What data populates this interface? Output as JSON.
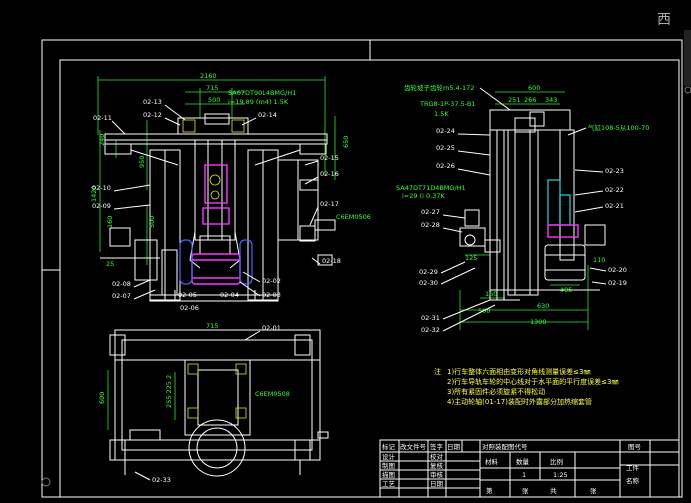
{
  "watermark": "西",
  "dims": {
    "d2160": "2160",
    "d715a": "715",
    "d500a": "500",
    "d240": "240",
    "d1420": "1420",
    "d950": "950",
    "d160a": "160",
    "d500v": "500",
    "d25": "25",
    "d650": "650",
    "d715b": "715",
    "d600b": "600",
    "d600r": "600",
    "d251": "251",
    "d266": "266",
    "d343": "343",
    "d125": "125",
    "d160b": "160",
    "d495": "495",
    "d110": "110",
    "d500c": "500",
    "d630": "630",
    "d1300": "1300"
  },
  "callouts": {
    "c0211": "02-11",
    "c0213": "02-13",
    "c0212": "02-12",
    "c0214": "02-14",
    "c0210": "02-10",
    "c0209": "02-09",
    "c0215": "02-15",
    "c0216": "02-16",
    "c0217": "02-17",
    "c0218": "02-18",
    "c0208": "02-08",
    "c0207": "02-07",
    "c0205": "02-05",
    "c0206": "02-06",
    "c0204": "02-04",
    "c0202": "02-02",
    "c0203": "02-03",
    "c0201": "02-01",
    "c0233": "02-33",
    "c0224": "02-24",
    "c0225": "02-25",
    "c0226": "02-26",
    "c0222": "02-22",
    "c0221": "02-21",
    "c0227": "02-27",
    "c0228": "02-28",
    "c0229": "02-29",
    "c0230": "02-30",
    "c0220": "02-20",
    "c0219": "02-19",
    "c0231": "02-31",
    "c0232": "02-32",
    "c0223": "02-23"
  },
  "notes_green": {
    "motor1": "SA67DT90L4BMG/H1",
    "motor1b": "i=19.89 (m4) 1.5K",
    "gear_spec": "齿轮坡子齿轮m5.4-172",
    "reducer": "TRG8-1P-37.5-B1",
    "reducer_b": "1.5K",
    "motor2": "SA47DT71D4BMG/H1",
    "motor2b": "i=29 (i 0.37K",
    "cyl": "气缸108-5从100-70",
    "bolt1": "C6EM0506",
    "bolt2": "C6EM0508"
  },
  "notes": {
    "label": "注",
    "n1": "1)行车整体六面相由变形对角线测量误差≤3㎜",
    "n2": "2)行车导轨车轮的中心线对于水平面的平行度误差≤3㎜",
    "n3": "3)所有紧固件必须旋紧不得松动",
    "n4": "4)主动轮轴(01-17)装配时外露部分加热缩套管"
  },
  "title_block": {
    "biaoji": "标记",
    "gaizhi": "改文件号",
    "qianzi": "签字",
    "riqi": "日期",
    "code_label": "对照装配图代号",
    "tuhao": "图号",
    "sheji": "设计",
    "xiaodui": "校对",
    "zhitu": "制图",
    "fuhe": "复核",
    "miaotu": "描图",
    "shenhe": "审核",
    "gongyi": "工艺",
    "riqi2": "日期",
    "cailiao": "材料",
    "shuliang": "数量",
    "bili": "比例",
    "gongjian": "工件",
    "qty": "1",
    "scale": "1:25",
    "mingcheng": "名称",
    "di": "第",
    "zhang1": "张",
    "gong": "共",
    "zhang2": "张"
  }
}
